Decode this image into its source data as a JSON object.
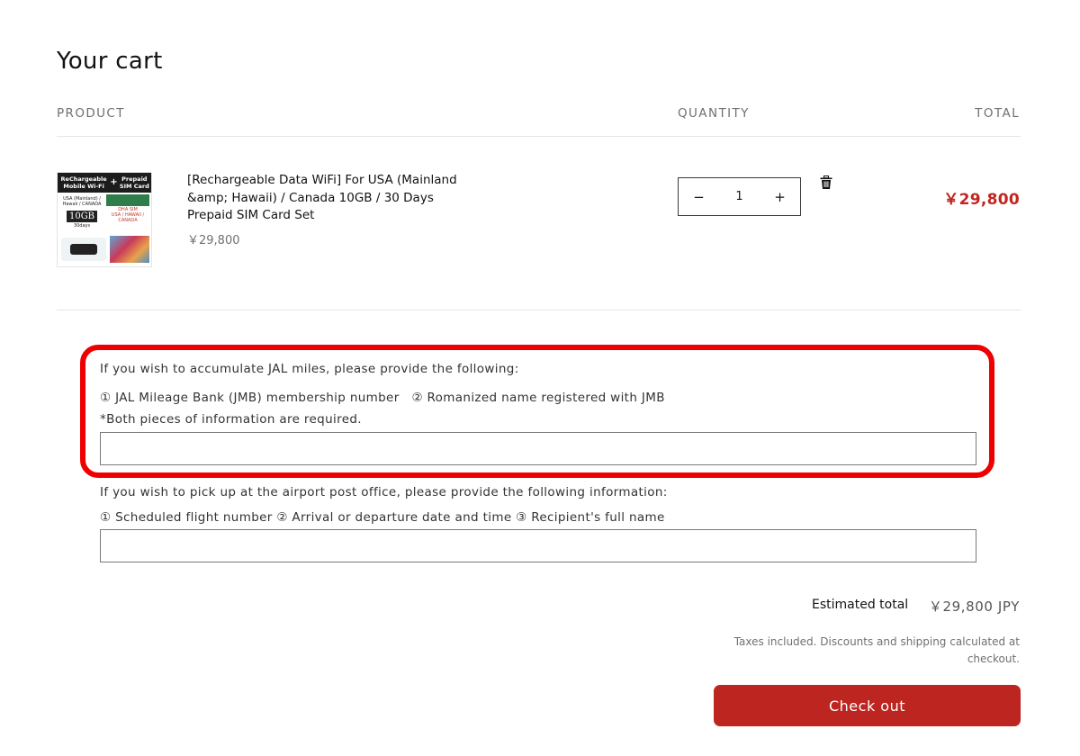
{
  "header": {
    "title": "Your cart"
  },
  "columns": {
    "product": "PRODUCT",
    "quantity": "QUANTITY",
    "total": "TOTAL"
  },
  "item": {
    "name": "[Rechargeable Data WiFi] For USA (Mainland &amp; Hawaii) / Canada 10GB / 30 Days Prepaid SIM Card Set",
    "unit_price": "￥29,800",
    "quantity": "1",
    "line_total": "￥29,800",
    "image_text": {
      "left_label": "ReChargeable Mobile Wi-Fi",
      "plus": "+",
      "right_label": "Prepaid SIM Card",
      "region": "USA (Mainland) / Hawaii / CANADA",
      "data": "10GB",
      "days": "30days",
      "sim_brand": "DHA SIM",
      "sim_region": "USA / HAWAII / CANADA"
    },
    "icons": {
      "decrease": "minus-icon",
      "increase": "plus-icon",
      "remove": "trash-icon"
    }
  },
  "jal_section": {
    "line1": "If you wish to accumulate JAL miles, please provide the following:",
    "line2": "① JAL Mileage Bank (JMB) membership number　② Romanized name registered with JMB",
    "line3": "*Both pieces of information are required.",
    "input_value": ""
  },
  "airport_section": {
    "line1": "If you wish to pick up at the airport post office, please provide the following information:",
    "line2": "① Scheduled flight number ② Arrival or departure date and time ③ Recipient's full name",
    "input_value": ""
  },
  "summary": {
    "estimated_label": "Estimated total",
    "estimated_value": "￥29,800 JPY",
    "tax_note": "Taxes included. Discounts and shipping calculated at checkout."
  },
  "checkout": {
    "label": "Check out"
  },
  "colors": {
    "accent": "#bd2520",
    "price_red": "#c0261f",
    "highlight_red": "#ee0000"
  }
}
